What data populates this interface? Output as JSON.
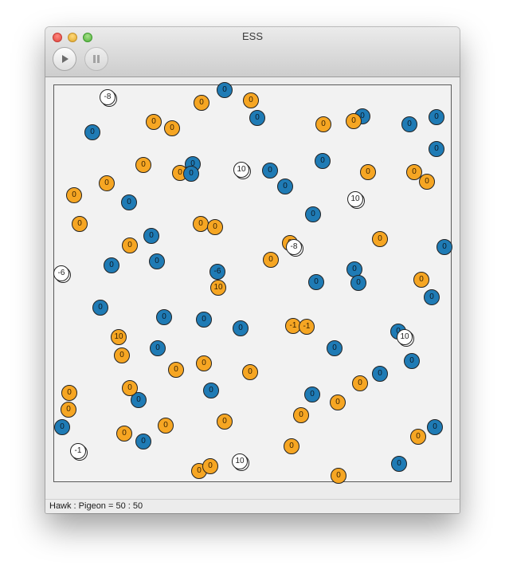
{
  "window": {
    "title": "ESS"
  },
  "toolbar": {
    "play_icon": "play-icon",
    "pause_icon": "pause-icon"
  },
  "status": {
    "text": "Hawk : Pigeon = 50 : 50"
  },
  "colors": {
    "hawk": "#1f7bb5",
    "pigeon": "#f6a623",
    "empty": "#ffffff"
  },
  "agents": [
    {
      "kind": "hawk",
      "label": "0"
    },
    {
      "kind": "pigeon",
      "label": "0"
    },
    {
      "kind": "pigeon",
      "label": "0"
    },
    {
      "kind": "empty",
      "label": "-8"
    },
    {
      "kind": "hawk",
      "label": "0"
    },
    {
      "kind": "pigeon",
      "label": "0"
    },
    {
      "kind": "hawk",
      "label": "0"
    },
    {
      "kind": "pigeon",
      "label": "0"
    },
    {
      "kind": "pigeon",
      "label": "0"
    },
    {
      "kind": "hawk",
      "label": "0"
    },
    {
      "kind": "pigeon",
      "label": "0"
    },
    {
      "kind": "hawk",
      "label": "0"
    },
    {
      "kind": "hawk",
      "label": "0"
    },
    {
      "kind": "pigeon",
      "label": "0"
    },
    {
      "kind": "hawk",
      "label": "0"
    },
    {
      "kind": "pigeon",
      "label": "0"
    },
    {
      "kind": "hawk",
      "label": "0"
    },
    {
      "kind": "hawk",
      "label": "0"
    },
    {
      "kind": "empty",
      "label": "10"
    },
    {
      "kind": "hawk",
      "label": "0"
    },
    {
      "kind": "hawk",
      "label": "0"
    },
    {
      "kind": "pigeon",
      "label": "0"
    },
    {
      "kind": "pigeon",
      "label": "0"
    },
    {
      "kind": "pigeon",
      "label": "0"
    },
    {
      "kind": "pigeon",
      "label": "0"
    },
    {
      "kind": "empty",
      "label": "10"
    },
    {
      "kind": "hawk",
      "label": "0"
    },
    {
      "kind": "pigeon",
      "label": "0"
    },
    {
      "kind": "hawk",
      "label": "0"
    },
    {
      "kind": "hawk",
      "label": "0"
    },
    {
      "kind": "pigeon",
      "label": "0"
    },
    {
      "kind": "pigeon",
      "label": "0"
    },
    {
      "kind": "pigeon",
      "label": "0"
    },
    {
      "kind": "pigeon",
      "label": "0"
    },
    {
      "kind": "hawk",
      "label": "0"
    },
    {
      "kind": "pigeon",
      "label": "0"
    },
    {
      "kind": "empty",
      "label": "-8"
    },
    {
      "kind": "hawk",
      "label": "0"
    },
    {
      "kind": "pigeon",
      "label": "0"
    },
    {
      "kind": "hawk",
      "label": "0"
    },
    {
      "kind": "hawk",
      "label": "0"
    },
    {
      "kind": "empty",
      "label": "-6"
    },
    {
      "kind": "hawk",
      "label": "-6"
    },
    {
      "kind": "pigeon",
      "label": "0"
    },
    {
      "kind": "hawk",
      "label": "0"
    },
    {
      "kind": "hawk",
      "label": "0"
    },
    {
      "kind": "hawk",
      "label": "0"
    },
    {
      "kind": "pigeon",
      "label": "0"
    },
    {
      "kind": "pigeon",
      "label": "10"
    },
    {
      "kind": "hawk",
      "label": "0"
    },
    {
      "kind": "hawk",
      "label": "0"
    },
    {
      "kind": "hawk",
      "label": "0"
    },
    {
      "kind": "hawk",
      "label": "0"
    },
    {
      "kind": "pigeon",
      "label": "10"
    },
    {
      "kind": "pigeon",
      "label": "0"
    },
    {
      "kind": "hawk",
      "label": "0"
    },
    {
      "kind": "hawk",
      "label": "0"
    },
    {
      "kind": "pigeon",
      "label": "-1"
    },
    {
      "kind": "pigeon",
      "label": "-1"
    },
    {
      "kind": "hawk",
      "label": "0"
    },
    {
      "kind": "empty",
      "label": "10"
    },
    {
      "kind": "hawk",
      "label": "0"
    },
    {
      "kind": "hawk",
      "label": "0"
    },
    {
      "kind": "pigeon",
      "label": "0"
    },
    {
      "kind": "pigeon",
      "label": "0"
    },
    {
      "kind": "pigeon",
      "label": "0"
    },
    {
      "kind": "pigeon",
      "label": "0"
    },
    {
      "kind": "hawk",
      "label": "0"
    },
    {
      "kind": "hawk",
      "label": "0"
    },
    {
      "kind": "pigeon",
      "label": "0"
    },
    {
      "kind": "hawk",
      "label": "0"
    },
    {
      "kind": "hawk",
      "label": "0"
    },
    {
      "kind": "pigeon",
      "label": "0"
    },
    {
      "kind": "pigeon",
      "label": "0"
    },
    {
      "kind": "pigeon",
      "label": "0"
    },
    {
      "kind": "hawk",
      "label": "0"
    },
    {
      "kind": "pigeon",
      "label": "0"
    },
    {
      "kind": "pigeon",
      "label": "0"
    },
    {
      "kind": "pigeon",
      "label": "0"
    },
    {
      "kind": "pigeon",
      "label": "0"
    },
    {
      "kind": "hawk",
      "label": "0"
    },
    {
      "kind": "pigeon",
      "label": "0"
    },
    {
      "kind": "hawk",
      "label": "0"
    },
    {
      "kind": "empty",
      "label": "-1"
    },
    {
      "kind": "pigeon",
      "label": "0"
    },
    {
      "kind": "empty",
      "label": "10"
    },
    {
      "kind": "pigeon",
      "label": "0"
    },
    {
      "kind": "pigeon",
      "label": "0"
    },
    {
      "kind": "pigeon",
      "label": "0"
    },
    {
      "kind": "hawk",
      "label": "0"
    },
    {
      "kind": "hawk",
      "label": "0"
    },
    {
      "kind": "pigeon",
      "label": "0"
    },
    {
      "kind": "hawk",
      "label": "0"
    },
    {
      "kind": "pigeon",
      "label": "0"
    },
    {
      "kind": "hawk",
      "label": "0"
    },
    {
      "kind": "pigeon",
      "label": "0"
    },
    {
      "kind": "pigeon",
      "label": "0"
    },
    {
      "kind": "hawk",
      "label": "0"
    },
    {
      "kind": "pigeon",
      "label": "0"
    },
    {
      "kind": "hawk",
      "label": "0"
    }
  ]
}
